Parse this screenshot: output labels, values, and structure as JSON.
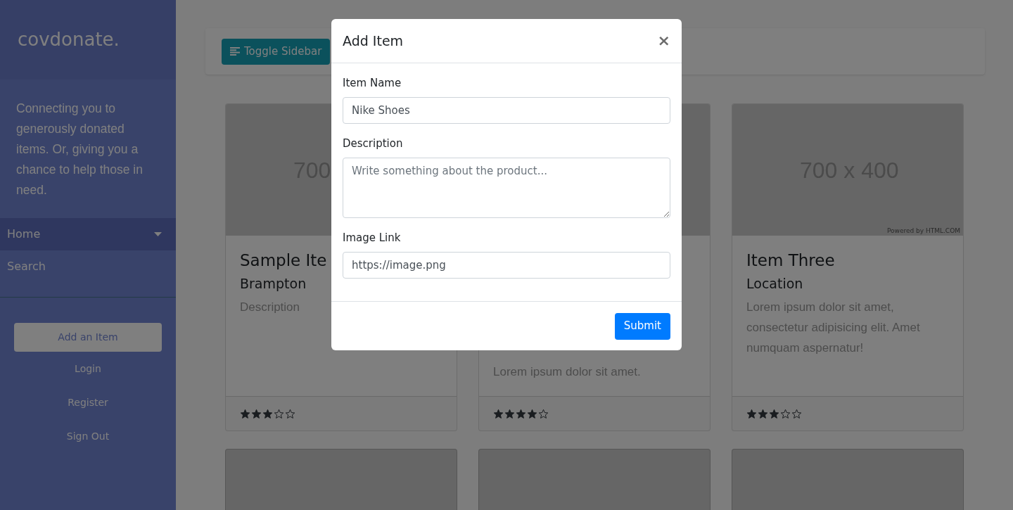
{
  "sidebar": {
    "brand": "covdonate.",
    "tagline": "Connecting you to generously donated items. Or, giving you a chance to help those in need.",
    "nav": [
      {
        "label": "Home",
        "selected": true,
        "dropdown": true
      },
      {
        "label": "Search",
        "selected": false,
        "dropdown": false
      }
    ],
    "cta": "Add an Item",
    "links": [
      "Login",
      "Register",
      "Sign Out"
    ]
  },
  "toolbar": {
    "button": "Toggle Sidebar"
  },
  "cards": [
    {
      "kind": "item",
      "image_text": "700",
      "title": "Sample Ite",
      "location": "Brampton",
      "description": "Description",
      "stars": 3
    },
    {
      "kind": "item",
      "description": "Lorem ipsum dolor sit amet.",
      "stars": 4
    },
    {
      "kind": "item",
      "image_text": "700 x 400",
      "image_credit": "Powered by HTML.COM",
      "title": "Item Three",
      "location": "Location",
      "description": "Lorem ipsum dolor sit amet, consectetur adipisicing elit. Amet numquam aspernatur!",
      "stars": 3
    },
    {
      "kind": "picture"
    },
    {
      "kind": "picture"
    },
    {
      "kind": "picture"
    }
  ],
  "modal": {
    "title": "Add Item",
    "close": "×",
    "fields": [
      {
        "label": "Item Name",
        "kind": "input",
        "value": "Nike Shoes"
      },
      {
        "label": "Description",
        "kind": "textarea",
        "placeholder": "Write something about the product..."
      },
      {
        "label": "Image Link",
        "kind": "input",
        "value": "https://image.png"
      }
    ],
    "submit": "Submit"
  }
}
